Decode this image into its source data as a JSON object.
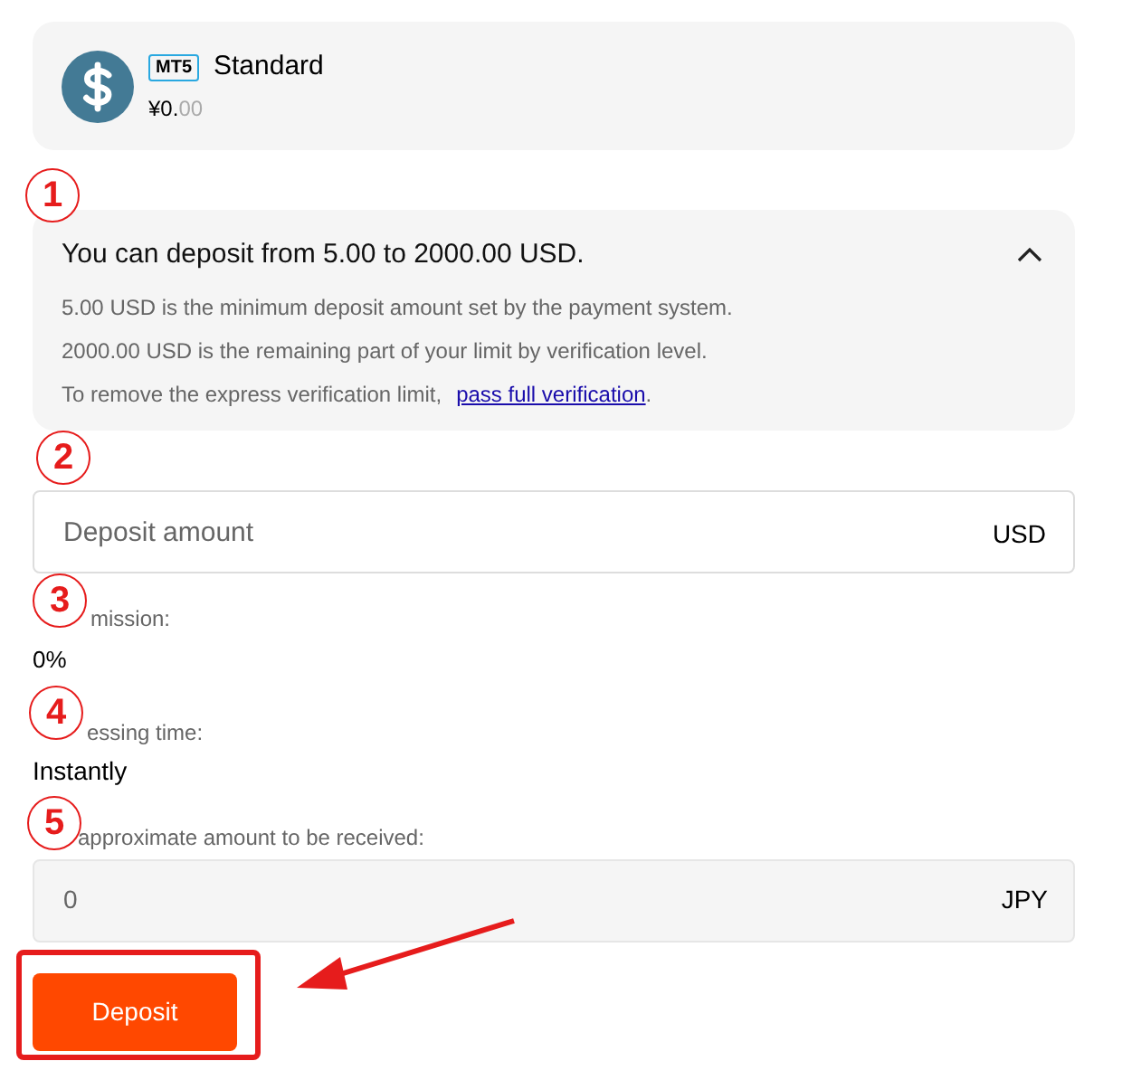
{
  "account": {
    "platform_badge": "MT5",
    "name": "Standard",
    "balance_main": "¥0.",
    "balance_decimals": "00"
  },
  "limits": {
    "expanded": true,
    "title": "You can deposit from 5.00 to 2000.00 USD.",
    "lines": [
      "5.00 USD is the minimum deposit amount set by the payment system.",
      "2000.00 USD is the remaining part of your limit by verification level."
    ],
    "note": "To remove the express verification limit,",
    "link": "pass full verification",
    "note_end": "."
  },
  "amount_field": {
    "placeholder": "Deposit amount",
    "currency": "USD"
  },
  "commission": {
    "label": "mission:",
    "value": "0%"
  },
  "processing_time": {
    "label": "essing time:",
    "value": "Instantly"
  },
  "received": {
    "label": "approximate amount to be received:",
    "value": "0",
    "currency": "JPY"
  },
  "deposit_button": {
    "label": "Deposit"
  },
  "annotations": {
    "markers": [
      "1",
      "2",
      "3",
      "4",
      "5"
    ]
  }
}
